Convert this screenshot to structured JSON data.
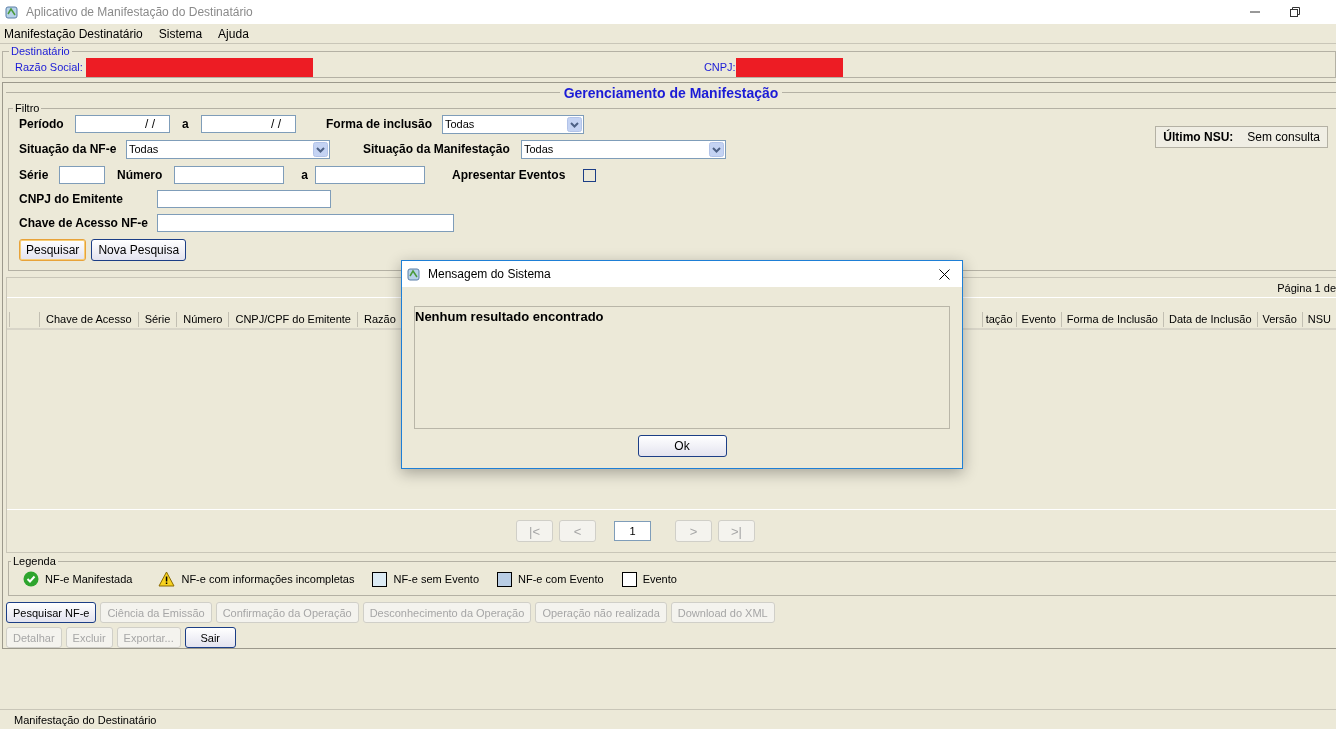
{
  "window": {
    "title": "Aplicativo de Manifestação do Destinatário"
  },
  "menu": [
    {
      "label": "Manifestação Destinatário"
    },
    {
      "label": "Sistema"
    },
    {
      "label": "Ajuda"
    }
  ],
  "destinatario": {
    "title": "Destinatário",
    "razao_label": "Razão Social:",
    "cnpj_label": "CNPJ:"
  },
  "panel_title": "Gerenciamento de Manifestação",
  "filter": {
    "title": "Filtro",
    "periodo": {
      "label": "Período",
      "from": "/ /",
      "to_label": "a",
      "to": "/ /"
    },
    "forma_inclusao": {
      "label": "Forma de inclusão",
      "value": "Todas"
    },
    "situacao_nfe": {
      "label": "Situação da NF-e",
      "value": "Todas"
    },
    "situacao_manifestacao": {
      "label": "Situação da Manifestação",
      "value": "Todas"
    },
    "serie": {
      "label": "Série"
    },
    "numero": {
      "label": "Número",
      "to_label": "a"
    },
    "apresentar_eventos": {
      "label": "Apresentar Eventos",
      "checked": false
    },
    "cnpj_emitente": {
      "label": "CNPJ do Emitente"
    },
    "chave_acesso": {
      "label": "Chave de Acesso NF-e"
    },
    "buttons": [
      {
        "label": "Pesquisar",
        "focused": true
      },
      {
        "label": "Nova Pesquisa",
        "focused": false
      }
    ]
  },
  "ultimo_nsu": {
    "label": "Último NSU:",
    "value": "Sem consulta"
  },
  "table": {
    "page_info": "Página 1 de",
    "columns_left": [
      "Chave de Acesso",
      "Série",
      "Número",
      "CNPJ/CPF do Emitente",
      "Razão"
    ],
    "columns_right": [
      "tação",
      "Evento",
      "Forma de Inclusão",
      "Data de Inclusão",
      "Versão",
      "NSU"
    ],
    "pagination": {
      "buttons": [
        {
          "label": "|<",
          "disabled": true
        },
        {
          "label": "<",
          "disabled": true
        },
        {
          "label": ">",
          "disabled": true
        },
        {
          "label": ">|",
          "disabled": true
        }
      ],
      "page": "1"
    }
  },
  "legend": {
    "title": "Legenda",
    "items": [
      {
        "kind": "check",
        "label": "NF-e Manifestada"
      },
      {
        "kind": "warning",
        "label": "NF-e com informações incompletas"
      },
      {
        "kind": "swatch",
        "color": "#dcebf4",
        "label": "NF-e sem Evento"
      },
      {
        "kind": "swatch",
        "color": "#b9cde4",
        "label": "NF-e com Evento"
      },
      {
        "kind": "swatch",
        "color": "#ffffff",
        "label": "Evento"
      }
    ]
  },
  "action_rows": [
    {
      "buttons": [
        {
          "label": "Pesquisar NF-e",
          "disabled": false
        },
        {
          "label": "Ciência da Emissão",
          "disabled": true
        },
        {
          "label": "Confirmação da Operação",
          "disabled": true
        },
        {
          "label": "Desconhecimento da Operação",
          "disabled": true
        },
        {
          "label": "Operação não realizada",
          "disabled": true
        },
        {
          "label": "Download do XML",
          "disabled": true
        }
      ]
    },
    {
      "buttons": [
        {
          "label": "Detalhar",
          "disabled": true
        },
        {
          "label": "Excluir",
          "disabled": true
        },
        {
          "label": "Exportar...",
          "disabled": true
        },
        {
          "label": "Sair",
          "disabled": false
        }
      ]
    }
  ],
  "status_bar": "Manifestação do Destinatário",
  "dialog": {
    "title": "Mensagem do Sistema",
    "message": "Nenhum resultado encontrado",
    "button": "Ok"
  }
}
